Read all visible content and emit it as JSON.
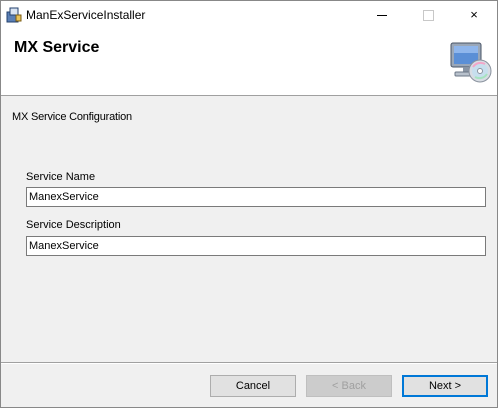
{
  "window": {
    "title": "ManExServiceInstaller",
    "controls": {
      "minimize": "minimize",
      "maximize": "maximize",
      "close": "×"
    }
  },
  "banner": {
    "title": "MX Service",
    "icon": "computer-cd-icon"
  },
  "section": {
    "label": "MX Service Configuration"
  },
  "form": {
    "service_name": {
      "label": "Service Name",
      "value": "ManexService"
    },
    "service_description": {
      "label": "Service Description",
      "value": "ManexService"
    }
  },
  "buttons": {
    "cancel": "Cancel",
    "back": "< Back",
    "next": "Next >"
  },
  "colors": {
    "accent": "#0078d7",
    "dialog_bg": "#f0f0f0",
    "banner_bg": "#ffffff"
  }
}
